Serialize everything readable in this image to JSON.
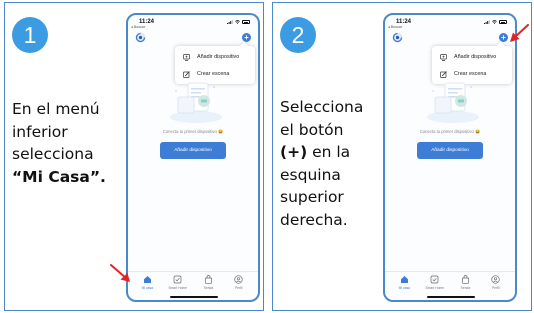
{
  "step1": {
    "number": "1",
    "instruction": [
      "En el menú",
      "inferior",
      "selecciona",
      "“Mi Casa”."
    ]
  },
  "step2": {
    "number": "2",
    "instruction": [
      "Selecciona",
      "el botón",
      "(+) en la",
      "esquina",
      "superior",
      "derecha."
    ]
  },
  "phone": {
    "time": "11:24",
    "back": "◂ Buscar",
    "add_symbol": "+",
    "menu": {
      "add_device": "Añadir dispositivo",
      "create_scene": "Crear escena"
    },
    "empty_text": "Conecta tu primer dispositivo 😀",
    "add_device_button": "Añadir dispositivo",
    "tabs": [
      "Mi casa",
      "Smart Home",
      "Tienda",
      "Perfil"
    ]
  },
  "colors": {
    "accent": "#3b9ce3",
    "button": "#3d7dd6",
    "arrow": "#e02424",
    "border": "#4a88c9"
  }
}
